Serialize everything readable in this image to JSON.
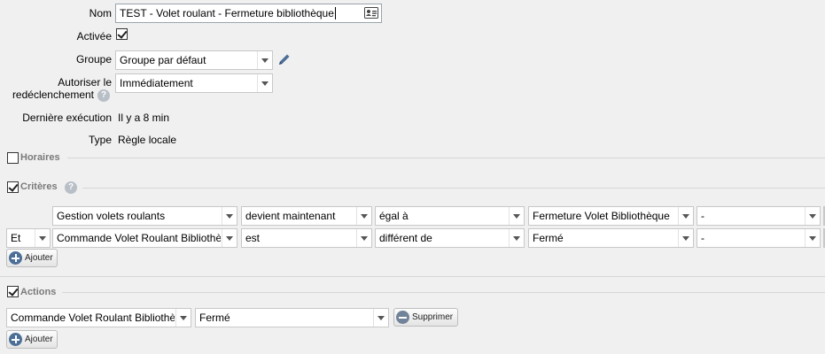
{
  "form": {
    "name_label": "Nom",
    "name_value": "TEST - Volet roulant - Fermeture bibliothèque",
    "active_label": "Activée",
    "group_label": "Groupe",
    "group_value": "Groupe par défaut",
    "retrigger_label_1": "Autoriser le",
    "retrigger_label_2": "redéclenchement",
    "retrigger_value": "Immédiatement",
    "last_run_label": "Dernière exécution",
    "last_run_value": "Il y a 8 min",
    "type_label": "Type",
    "type_value": "Règle locale"
  },
  "sections": {
    "schedules": "Horaires",
    "criteria": "Critères",
    "actions": "Actions"
  },
  "criteria": {
    "rows": [
      {
        "connector": "",
        "device": "Gestion volets roulants",
        "event": "devient maintenant",
        "operator": "égal à",
        "value": "Fermeture Volet Bibliothèque",
        "extra": "-"
      },
      {
        "connector": "Et",
        "device": "Commande Volet Roulant Bibliothèque",
        "event": "est",
        "operator": "différent de",
        "value": "Fermé",
        "extra": "-"
      }
    ],
    "add_label": "Ajouter"
  },
  "actions": {
    "device": "Commande Volet Roulant Bibliothèque",
    "value": "Fermé",
    "delete_label": "Supprimer",
    "add_label": "Ajouter"
  },
  "icons": {
    "help": "?",
    "contact-card": "contact-card-icon",
    "pencil": "pencil-icon"
  }
}
